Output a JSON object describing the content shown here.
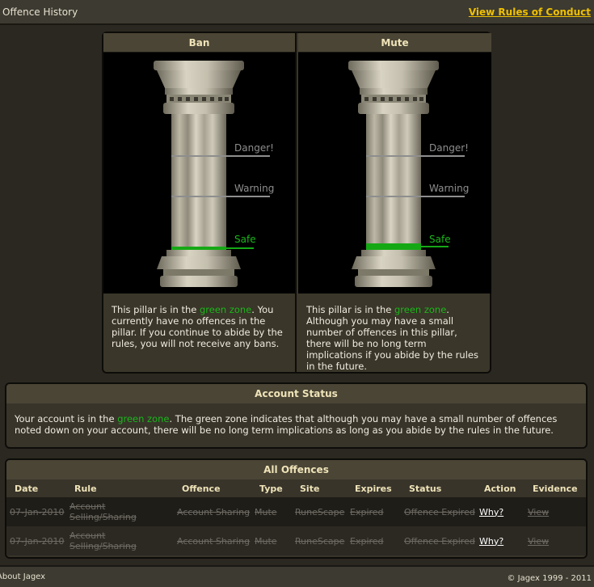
{
  "header": {
    "title": "Offence History",
    "rules_link": "View Rules of Conduct"
  },
  "pillars": [
    {
      "name": "Ban",
      "label_danger": "Danger!",
      "label_warning": "Warning",
      "label_safe": "Safe",
      "level": "safe",
      "text_pre": "This pillar is in the ",
      "text_zone": "green zone",
      "text_post": ". You currently have no offences in the pillar. If you continue to abide by the rules, you will not receive any bans."
    },
    {
      "name": "Mute",
      "label_danger": "Danger!",
      "label_warning": "Warning",
      "label_safe": "Safe",
      "level": "safe",
      "text_pre": "This pillar is in the ",
      "text_zone": "green zone",
      "text_post": ". Although you may have a small number of offences in this pillar, there will be no long term implications if you abide by the rules in the future."
    }
  ],
  "account_status": {
    "title": "Account Status",
    "text_pre": "Your account is in the ",
    "text_zone": "green zone",
    "text_post": ". The green zone indicates that although you may have a small number of offences noted down on your account, there will be no long term implications as long as you abide by the rules in the future."
  },
  "offences": {
    "title": "All Offences",
    "columns": [
      "Date",
      "Rule",
      "Offence",
      "Type",
      "Site",
      "Expires",
      "Status",
      "Action",
      "Evidence"
    ],
    "rows": [
      {
        "date": "07-Jan-2010",
        "rule": "Account Selling/Sharing",
        "offence": "Account Sharing",
        "type": "Mute",
        "site": "RuneScape",
        "expires": "Expired",
        "status": "Offence Expired",
        "action": "Why?",
        "evidence": "View"
      },
      {
        "date": "07-Jan-2010",
        "rule": "Account Selling/Sharing",
        "offence": "Account Sharing",
        "type": "Mute",
        "site": "RuneScape",
        "expires": "Expired",
        "status": "Offence Expired",
        "action": "Why?",
        "evidence": "View"
      }
    ]
  },
  "footer": {
    "left": "About Jagex",
    "right": "© Jagex 1999 - 2011"
  },
  "colors": {
    "accent_gold": "#f0c000",
    "green_zone": "#1bb61b"
  }
}
